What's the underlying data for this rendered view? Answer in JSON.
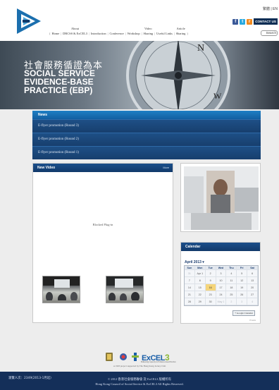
{
  "header": {
    "lang": "繁體 | EN",
    "contact_label": "CONTACT US",
    "search_label": "Search",
    "social": [
      {
        "name": "facebook-icon",
        "glyph": "f"
      },
      {
        "name": "twitter-icon",
        "glyph": "t"
      },
      {
        "name": "rss-icon",
        "glyph": "r"
      }
    ],
    "nav": [
      {
        "top": "",
        "main": "Home"
      },
      {
        "top": "About",
        "main": "DRCSS & ExCEL3"
      },
      {
        "top": "",
        "main": "Introduction"
      },
      {
        "top": "",
        "main": "Conference"
      },
      {
        "top": "",
        "main": "Workshop"
      },
      {
        "top": "Video",
        "main": "Sharing"
      },
      {
        "top": "",
        "main": "Useful Links"
      },
      {
        "top": "Article",
        "main": "Sharing"
      }
    ]
  },
  "banner": {
    "title_cn": "社會服務循證為本",
    "title_en": "SOCIAL SERVICE EVIDENCE-BASE PRACTICE (EBP)",
    "compass_marks": [
      "N",
      "W"
    ]
  },
  "news": {
    "heading": "News",
    "items": [
      "E-flyer promotion (Round 3)",
      "E-flyer promotion (Round 2)",
      "E-flyer promotion (Round 1)"
    ]
  },
  "video": {
    "heading": "New Video",
    "more": "More",
    "plugin_text": "Blocked Plug-in"
  },
  "calendar": {
    "heading": "Calendar",
    "month_label": "April 2013",
    "days": [
      "Sun",
      "Mon",
      "Tue",
      "Wed",
      "Thu",
      "Fri",
      "Sat"
    ],
    "weeks": [
      [
        "31",
        "Apr 1",
        "2",
        "3",
        "4",
        "5",
        "6"
      ],
      [
        "7",
        "8",
        "9",
        "10",
        "11",
        "12",
        "13"
      ],
      [
        "14",
        "15",
        "16",
        "17",
        "18",
        "19",
        "20"
      ],
      [
        "21",
        "22",
        "23",
        "24",
        "25",
        "26",
        "27"
      ],
      [
        "28",
        "29",
        "30",
        "May 1",
        "2",
        "3",
        "4"
      ]
    ],
    "today": "16",
    "gcal_label": "Google Calendar",
    "footer": "Events"
  },
  "footer": {
    "excel_logo_text": "ExCEL",
    "excel_logo_num": "3",
    "excel_sub": "Enhancing Capacity in Evidence-based Practice",
    "partner_note": "A 1993 project supported by The Hong Kong Jockey Club",
    "visits": "瀏覽人次：2349(2013-1月起)",
    "copyright_line1": "© 2012 香港社會服務聯會 及 ExCEL3 版權所有",
    "copyright_line2": "Hong Kong Council of Social Service & ExCEL3 All Rights Reserved."
  }
}
